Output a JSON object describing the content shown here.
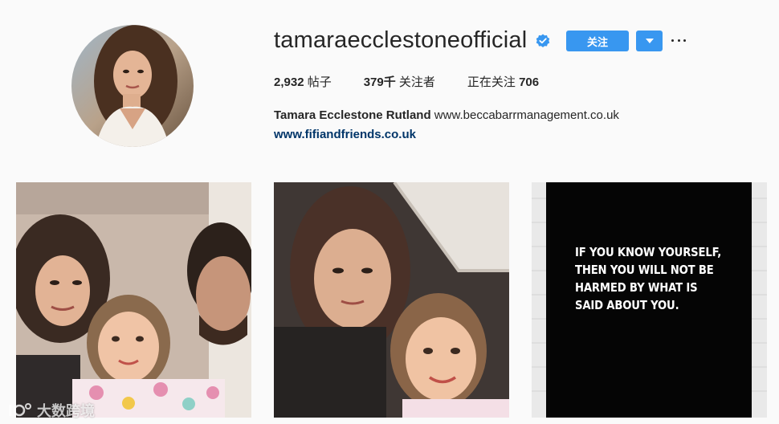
{
  "profile": {
    "username": "tamaraecclestoneofficial",
    "verified_icon": "verified-badge-icon",
    "follow_label": "关注",
    "stats": {
      "posts_count": "2,932",
      "posts_label": " 帖子",
      "followers_count": "379千",
      "followers_label": " 关注者",
      "following_label": "正在关注 ",
      "following_count": "706"
    },
    "full_name": "Tamara Ecclestone Rutland",
    "bio_text": " www.beccabarrmanagement.co.uk",
    "website": "www.fifiandfriends.co.uk"
  },
  "posts": [
    {
      "id": "post-1",
      "description": "selfie"
    },
    {
      "id": "post-2",
      "description": "selfie"
    },
    {
      "id": "post-3",
      "quote": "IF YOU KNOW YOURSELF, THEN YOU WILL NOT BE HARMED BY WHAT IS SAID ABOUT YOU."
    }
  ],
  "watermark": {
    "text": "大数跨境"
  },
  "colors": {
    "accent": "#3897f0",
    "link": "#003569",
    "background": "#fafafa"
  }
}
